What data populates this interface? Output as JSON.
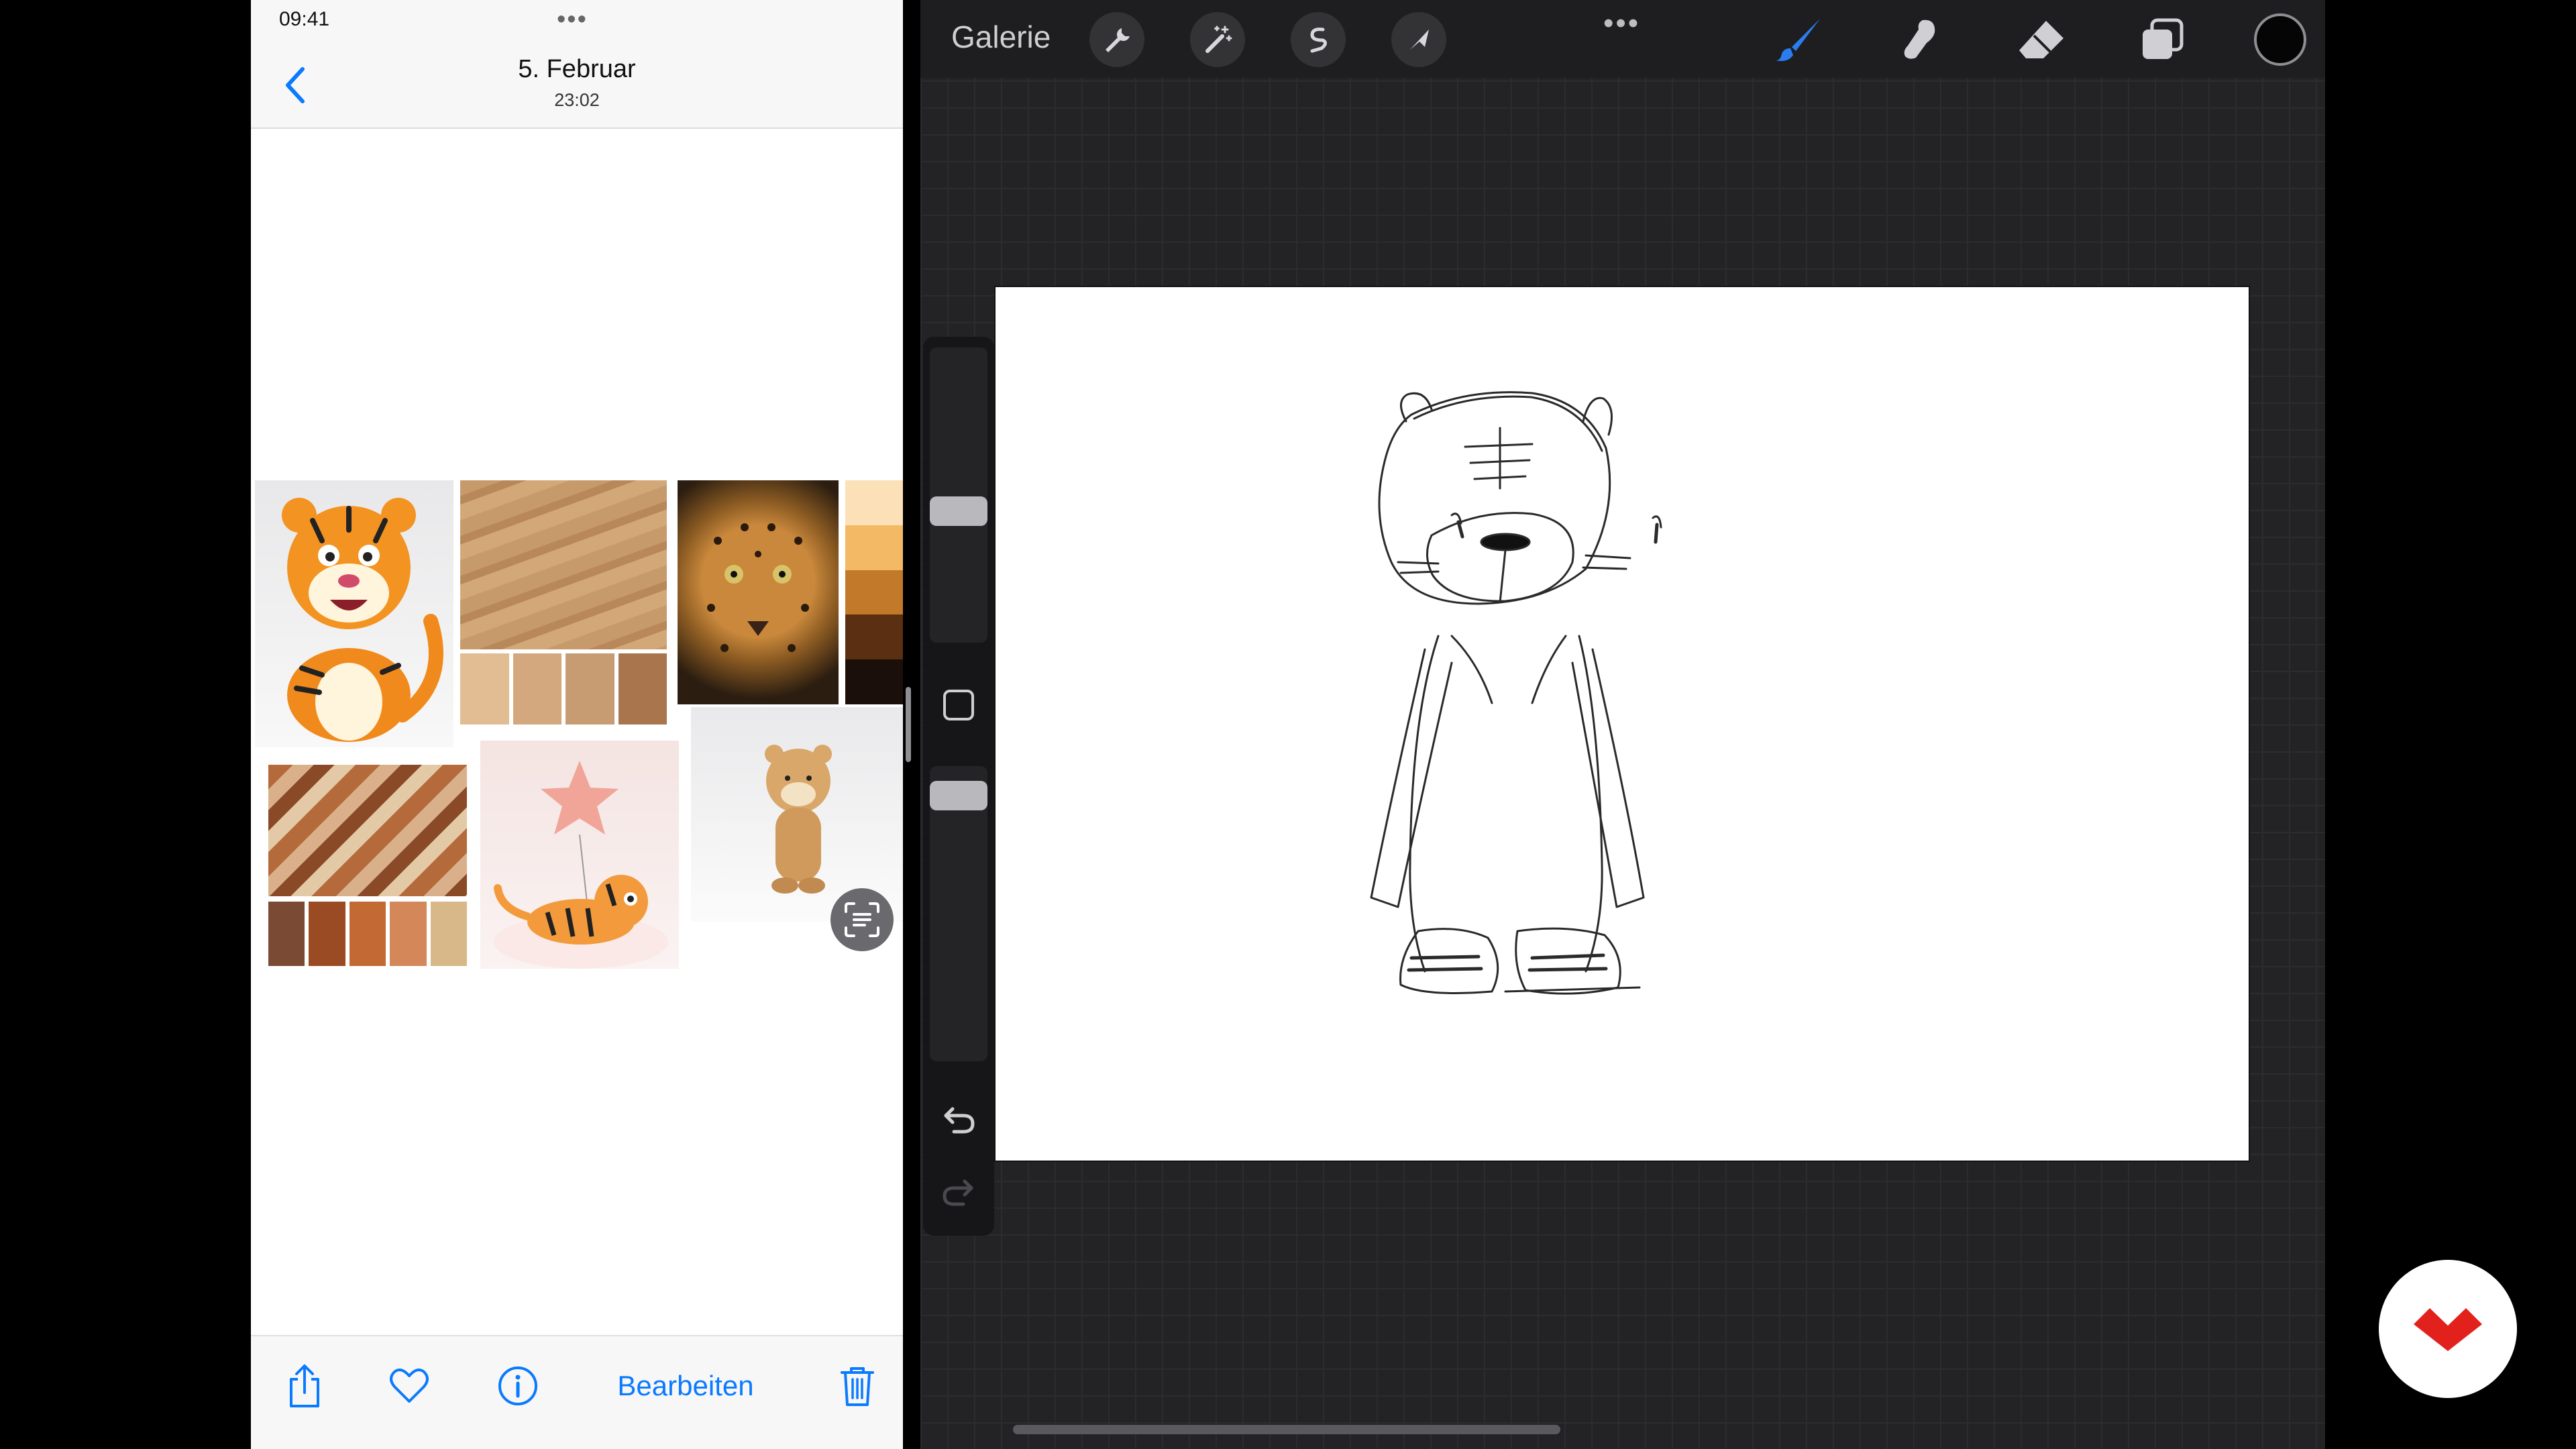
{
  "status_bar": {
    "time": "09:41"
  },
  "photos": {
    "header": {
      "title": "5. Februar",
      "subtitle": "23:02"
    },
    "toolbar": {
      "edit_label": "Bearbeiten"
    },
    "collage": {
      "sand_swatch_colors": [
        "#e2bc92",
        "#d4a87e",
        "#c89c72",
        "#a8754d"
      ],
      "palette_strip_colors": [
        "#fbe0b8",
        "#f4b964",
        "#c27a2a",
        "#5a2f12",
        "#1a0f0a"
      ],
      "waves_swatch_colors": [
        "#7a4a34",
        "#9a4b24",
        "#c36a34",
        "#d4885a",
        "#d8b888"
      ]
    }
  },
  "procreate": {
    "gallery_label": "Galerie",
    "tools": {
      "left": [
        "wrench-icon",
        "magic-wand-icon",
        "selection-icon",
        "transform-arrow-icon"
      ],
      "right": [
        "brush-icon",
        "smudge-icon",
        "eraser-icon",
        "layers-icon"
      ]
    },
    "active_color": "#050505",
    "accent_color": "#2a7df0"
  },
  "brand": {
    "color": "#e2211c"
  }
}
